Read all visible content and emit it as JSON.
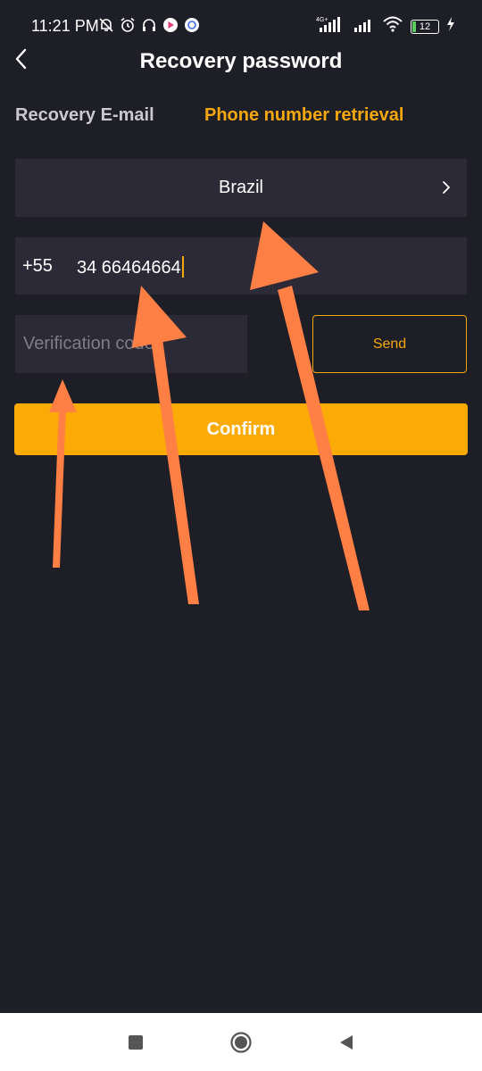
{
  "status_bar": {
    "time": "11:21 PM",
    "battery": "12",
    "network": "4G+"
  },
  "header": {
    "title": "Recovery password"
  },
  "tabs": [
    {
      "label": "Recovery E-mail",
      "active": false
    },
    {
      "label": "Phone number retrieval",
      "active": true
    }
  ],
  "form": {
    "country": "Brazil",
    "dial_code": "+55",
    "phone_number": "34 66464664",
    "code_placeholder": "Verification code",
    "send_label": "Send",
    "confirm_label": "Confirm"
  },
  "colors": {
    "background": "#1e1e27",
    "field": "#2b2a36",
    "accent": "#f5a80e",
    "confirm": "#fcaa06",
    "annotation_arrow": "#ff7f45"
  },
  "icons": {
    "back": "chevron-left-icon",
    "country_chevron": "chevron-right-icon",
    "nav_recent": "square-icon",
    "nav_home": "circle-icon",
    "nav_back": "triangle-left-icon"
  }
}
